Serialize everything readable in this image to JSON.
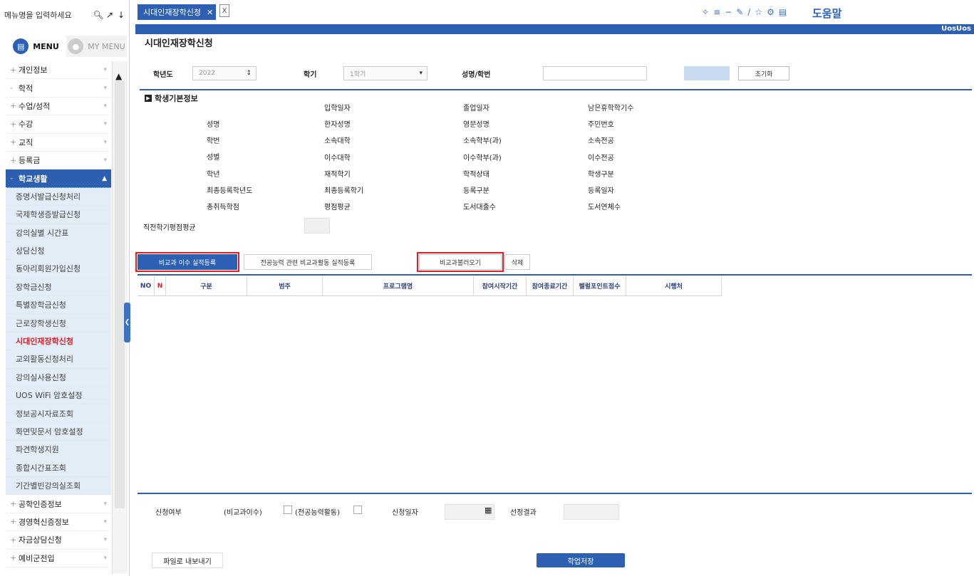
{
  "sidebar": {
    "search_placeholder": "메뉴명을 입력하세요",
    "menu_tab": "MENU",
    "mymenu_tab": "MY MENU",
    "top_items": [
      {
        "label": "개인정보",
        "prefix": "+"
      },
      {
        "label": "학적",
        "prefix": "-"
      },
      {
        "label": "수업/성적",
        "prefix": "+"
      },
      {
        "label": "수강",
        "prefix": "+"
      },
      {
        "label": "교직",
        "prefix": "+"
      },
      {
        "label": "등록금",
        "prefix": "+"
      }
    ],
    "group": {
      "label": "학교생활",
      "prefix": "-"
    },
    "sub_items": [
      "증명서발급신청처리",
      "국제학생증발급신청",
      "강의실별 시간표",
      "상담신청",
      "동아리회원가입신청",
      "장학금신청",
      "특별장학금신청",
      "근로장학생신청",
      "시대인재장학신청",
      "교외활동신청처리",
      "강의실사용신청",
      "UOS WiFi 암호설정",
      "정보공시자료조회",
      "화면및문서 암호설정",
      "파견학생지원",
      "종합시간표조회",
      "기간별빈강의실조회"
    ],
    "active_sub": "시대인재장학신청",
    "bottom_items": [
      {
        "label": "공학인증정보",
        "prefix": "+"
      },
      {
        "label": "경영혁신증정보",
        "prefix": "+"
      },
      {
        "label": "자금상담신청",
        "prefix": "+"
      },
      {
        "label": "예비군전입",
        "prefix": "+"
      }
    ]
  },
  "tabbar": {
    "active_tab": "시대인재장학신청",
    "help": "도움말",
    "bar_text": "UosUos"
  },
  "page_title": "시대인재장학신청",
  "filters": {
    "year_label": "학년도",
    "year_value": "2022",
    "term_label": "학기",
    "term_value": "1학기",
    "name_label": "성명/학번",
    "reset_button": "초기화"
  },
  "student_info": {
    "heading": "학생기본정보",
    "col1": [
      "성명",
      "학번",
      "성별",
      "학년",
      "최종등록학년도",
      "총취득학점"
    ],
    "col2": [
      "입학일자",
      "한자성명",
      "소속대학",
      "이수대학",
      "재적학기",
      "최종등록학기",
      "평점평균"
    ],
    "col3": [
      "졸업일자",
      "영문성명",
      "소속학부(과)",
      "이수학부(과)",
      "학적상태",
      "등록구분",
      "도서대출수"
    ],
    "col4": [
      "남은휴학학기수",
      "주민번호",
      "소속전공",
      "이수전공",
      "학생구분",
      "등록일자",
      "도서연체수"
    ],
    "gpa_label": "직전학기평점평균"
  },
  "subtabs": {
    "tab1": "비교과 이수 실적등록",
    "tab2": "전공능력 관련 비교과활동 실적등록",
    "tab3": "비교과불러오기",
    "tab4": "삭제"
  },
  "grid": {
    "columns": [
      "NO",
      "N",
      "구분",
      "범주",
      "프로그램명",
      "참여시작기간",
      "참여종료기간",
      "렐럴포인트점수",
      "시행처"
    ]
  },
  "bottom": {
    "apply_label": "신청여부",
    "opt1": "(비교과이수)",
    "opt2": "(전공능력활동)",
    "date_label": "신청일자",
    "result_label": "선정결과",
    "excel_button": "파일로 내보내기",
    "save_button": "학업저장"
  },
  "colors": {
    "primary": "#2d5fb3",
    "highlight": "#e02020",
    "active_menu": "#d2232a"
  }
}
